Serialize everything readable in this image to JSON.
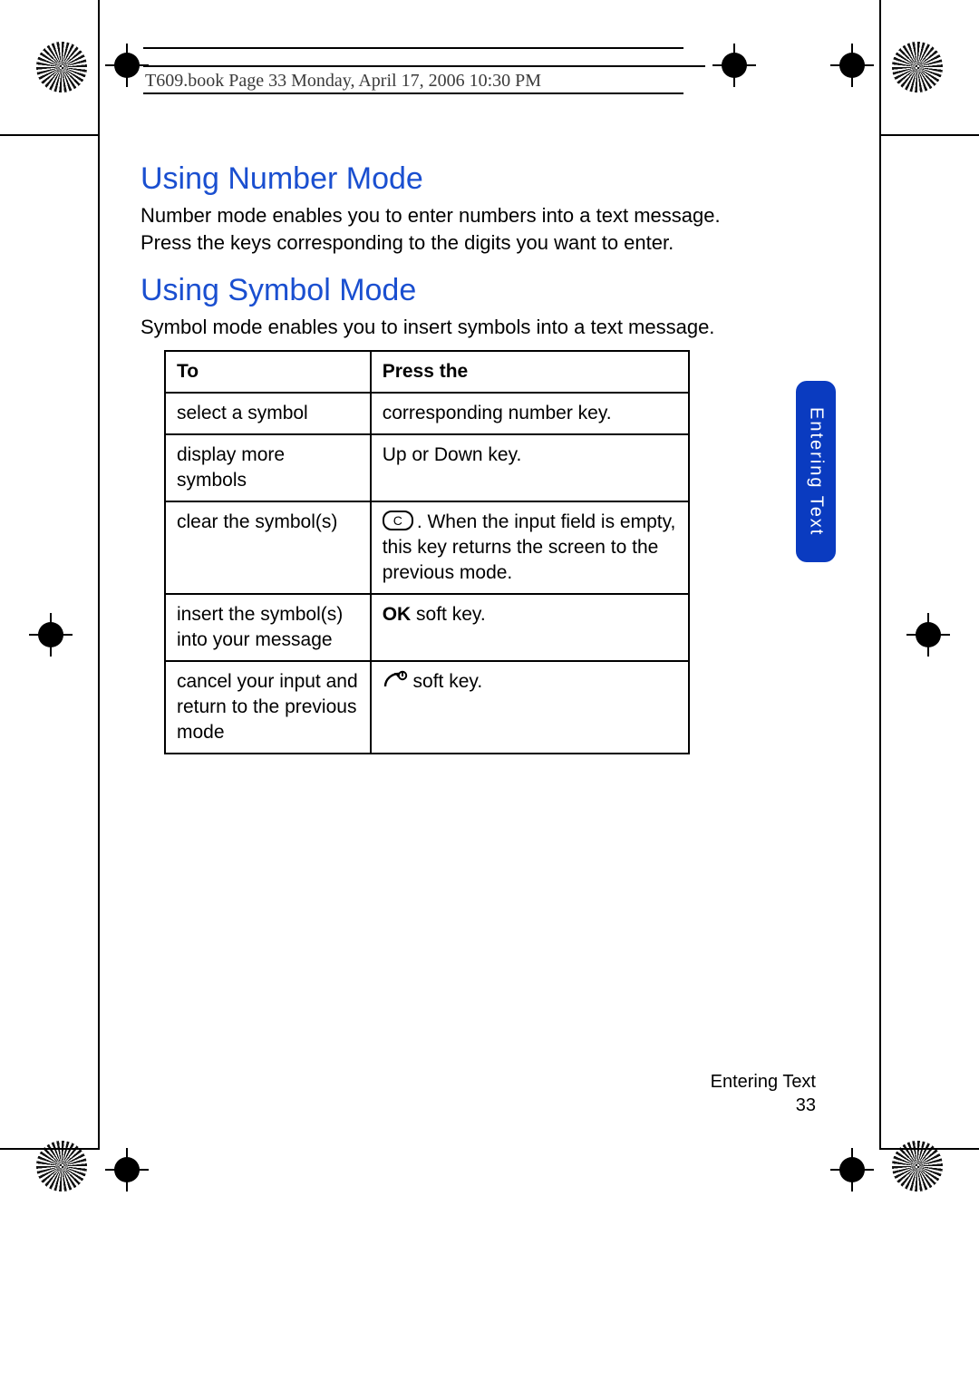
{
  "runhead": "T609.book  Page 33  Monday, April 17, 2006  10:30 PM",
  "headings": {
    "number": "Using Number Mode",
    "symbol": "Using Symbol Mode"
  },
  "paragraphs": {
    "number": "Number mode enables you to enter numbers into a text message. Press the keys corresponding to the digits you want to enter.",
    "symbol": "Symbol mode enables you to insert symbols into a text message."
  },
  "table": {
    "head": {
      "to": "To",
      "press": "Press the"
    },
    "rows": [
      {
        "to": "select a symbol",
        "press": "corresponding number key."
      },
      {
        "to": "display more symbols",
        "press": "Up or Down key."
      },
      {
        "to": "clear the symbol(s)",
        "press_key": "C",
        "press_tail": ". When the input field is empty, this key returns the screen to the previous mode."
      },
      {
        "to": "insert the symbol(s) into your message",
        "press_bold": "OK",
        "press_tail": " soft key."
      },
      {
        "to": "cancel your input and return to the previous mode",
        "press_icon": "power",
        "press_tail": " soft key."
      }
    ]
  },
  "sidetab": "Entering Text",
  "footer": {
    "section": "Entering Text",
    "page": "33"
  }
}
